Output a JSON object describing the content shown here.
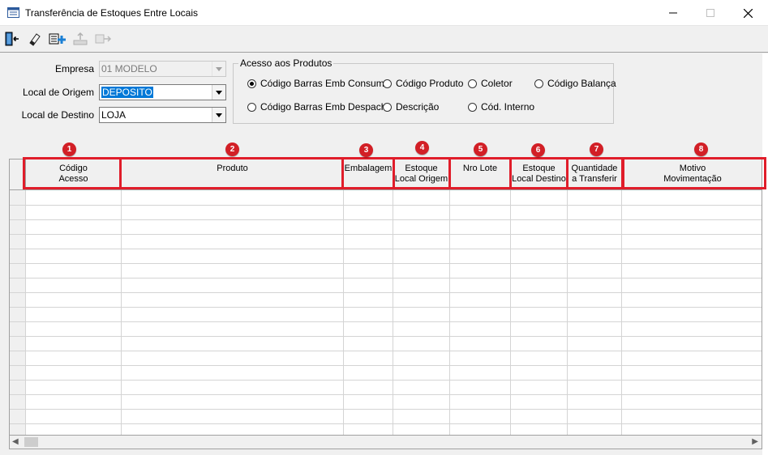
{
  "window": {
    "title": "Transferência de Estoques Entre Locais"
  },
  "form": {
    "empresa_label": "Empresa",
    "empresa_value": "01 MODELO",
    "origem_label": "Local de Origem",
    "origem_value": "DEPOSITO",
    "destino_label": "Local de Destino",
    "destino_value": "LOJA"
  },
  "acesso": {
    "legend": "Acesso aos Produtos",
    "options": [
      {
        "label": "Código Barras Emb Consumo",
        "selected": true
      },
      {
        "label": "Código Produto",
        "selected": false
      },
      {
        "label": "Coletor",
        "selected": false
      },
      {
        "label": "Código Balança",
        "selected": false
      },
      {
        "label": "Código Barras Emb Despacho",
        "selected": false
      },
      {
        "label": "Descrição",
        "selected": false
      },
      {
        "label": "Cód. Interno",
        "selected": false
      }
    ]
  },
  "grid": {
    "columns": [
      {
        "line1": "Código",
        "line2": "Acesso",
        "badge": "1"
      },
      {
        "line1": "Produto",
        "line2": "",
        "badge": "2"
      },
      {
        "line1": "Embalagem",
        "line2": "",
        "badge": "3"
      },
      {
        "line1": "Estoque",
        "line2": "Local Origem",
        "badge": "4"
      },
      {
        "line1": "Nro Lote",
        "line2": "",
        "badge": "5"
      },
      {
        "line1": "Estoque",
        "line2": "Local Destino",
        "badge": "6"
      },
      {
        "line1": "Quantidade",
        "line2": "a Transferir",
        "badge": "7"
      },
      {
        "line1": "Motivo",
        "line2": "Movimentação",
        "badge": "8"
      }
    ]
  },
  "colors": {
    "highlight": "#e01d2a",
    "badge": "#d21f26",
    "selection": "#0078d7"
  }
}
